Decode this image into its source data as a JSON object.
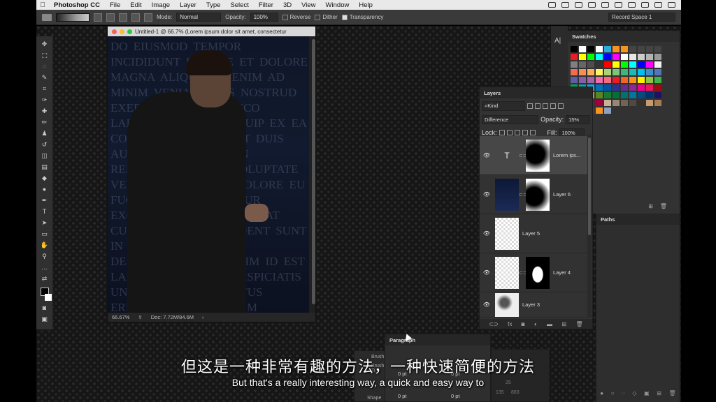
{
  "menubar": {
    "app_name": "Photoshop CC",
    "items": [
      "File",
      "Edit",
      "Image",
      "Layer",
      "Type",
      "Select",
      "Filter",
      "3D",
      "View",
      "Window",
      "Help"
    ]
  },
  "options": {
    "mode_label": "Mode:",
    "mode_value": "Normal",
    "opacity_label": "Opacity:",
    "opacity_value": "100%",
    "reverse_label": "Reverse",
    "dither_label": "Dither",
    "transparency_label": "Transparency",
    "workspace": "Record Space 1"
  },
  "document": {
    "title": "Untitled-1 @ 66.7% (Lorem ipsum dolor sit amet, consectetur",
    "bg_text": "DO EIUSMOD TEMPOR INCIDIDUNT LABORE ET DOLORE MAGNA ALIQUA UT ENIM AD MINIM VENIAM QUIS NOSTRUD EXERCITATION ULLAMCO LABORIS NISI UT ALIQUIP EX EA COMMODO CONSEQUAT DUIS AUTE IRURE DOLOR IN REPREHENDERIT IN VOLUPTATE VELIT ESSE CILLUM DOLORE EU FUGIAT NULLA PARIATUR EXCEPTEUR SINT OCCAECAT CUPIDATAT NON PROIDENT SUNT IN CULPA QUI OFFICIA DESERUNT MOLLIT ANIM ID EST LABORUM SED UT PERSPICIATIS UNDE OMNIS ISTE NATUS ERROR SIT VOLUPTATEM ACCUSANTIUM DOLOREMQUE LAUDANTIUM TOTAM REM APERIAM EAQUE IPSA QUAE AB ILLO INVENTORE VERITATIS ET QUASI ARCHITECTO BEATAE VITAE DICTA SUNT EXPLICABO NEMO ENIM IPSAM VOLUPTATEM QUIA VOLUPTAS",
    "zoom": "66.67%",
    "doc_size": "Doc: 7.72M/84.6M"
  },
  "swatches": {
    "title": "Swatches",
    "colors": [
      "#000000",
      "#ffffff",
      "#000000",
      "#ffffff",
      "#29abe2",
      "#f7931e",
      "#f7931e",
      "#444444",
      "#444444",
      "#444444",
      "#444444",
      "#ed1c24",
      "#ffff00",
      "#00ff00",
      "#00ffff",
      "#0000ff",
      "#ff00ff",
      "#ffffff",
      "#e6e6e6",
      "#cccccc",
      "#b3b3b3",
      "#999999",
      "#808080",
      "#666666",
      "#4d4d4d",
      "#333333",
      "#ff0000",
      "#ffff00",
      "#00ff00",
      "#00ffff",
      "#0000ff",
      "#ff00ff",
      "#f2f2f2",
      "#f26c4f",
      "#f68e56",
      "#fbaf5c",
      "#fff467",
      "#acd372",
      "#7cc576",
      "#3bb878",
      "#1abbb4",
      "#00bff3",
      "#438ccb",
      "#5574b9",
      "#605ca8",
      "#855fa8",
      "#a763a8",
      "#f06ea9",
      "#f26d7d",
      "#ed1c24",
      "#f26522",
      "#f7941d",
      "#fff200",
      "#8dc63f",
      "#39b54a",
      "#00a651",
      "#00a99d",
      "#00aeef",
      "#0072bc",
      "#0054a6",
      "#2e3192",
      "#662d91",
      "#92278f",
      "#ec008c",
      "#ed145b",
      "#9e0b0f",
      "#a0410d",
      "#a3620a",
      "#aba000",
      "#598527",
      "#1a7b30",
      "#007236",
      "#00746b",
      "#0076a3",
      "#004b80",
      "#003471",
      "#1b1464",
      "#440e62",
      "#630460",
      "#9e005d",
      "#9e0039",
      "#c7b299",
      "#998675",
      "#736357",
      "#534741",
      "#37302d",
      "#c69c6d",
      "#a67c52",
      "#8c6239",
      "#754c24",
      "#603913",
      "#f7931e",
      "#8ea0c0"
    ],
    "footer_icons": [
      "new-swatch-icon",
      "trash-icon"
    ]
  },
  "paths": {
    "title": "Paths"
  },
  "layers": {
    "title": "Layers",
    "filter_kind": "Kind",
    "blend_mode": "Difference",
    "opacity_label": "Opacity:",
    "opacity_value": "15%",
    "lock_label": "Lock:",
    "fill_label": "Fill:",
    "fill_value": "100%",
    "items": [
      {
        "name": "Lorem ips..."
      },
      {
        "name": "Layer 6"
      },
      {
        "name": "Layer 5"
      },
      {
        "name": "Layer 4"
      },
      {
        "name": "Layer 3"
      }
    ]
  },
  "paragraph": {
    "title": "Paragraph",
    "field1": "0 pt",
    "field2": "0 pt",
    "field3": "0 pt",
    "field4": "0 pt"
  },
  "brush": {
    "label1": "Brush",
    "label2": "Brush Ti",
    "label3": "Shape"
  },
  "mini_right": {
    "v1": "25",
    "v2": "135",
    "v3": "883"
  },
  "subtitles": {
    "chinese": "但这是一种非常有趣的方法，一种快速简便的方法",
    "english": "But that's a really interesting way, a quick and easy way to"
  }
}
